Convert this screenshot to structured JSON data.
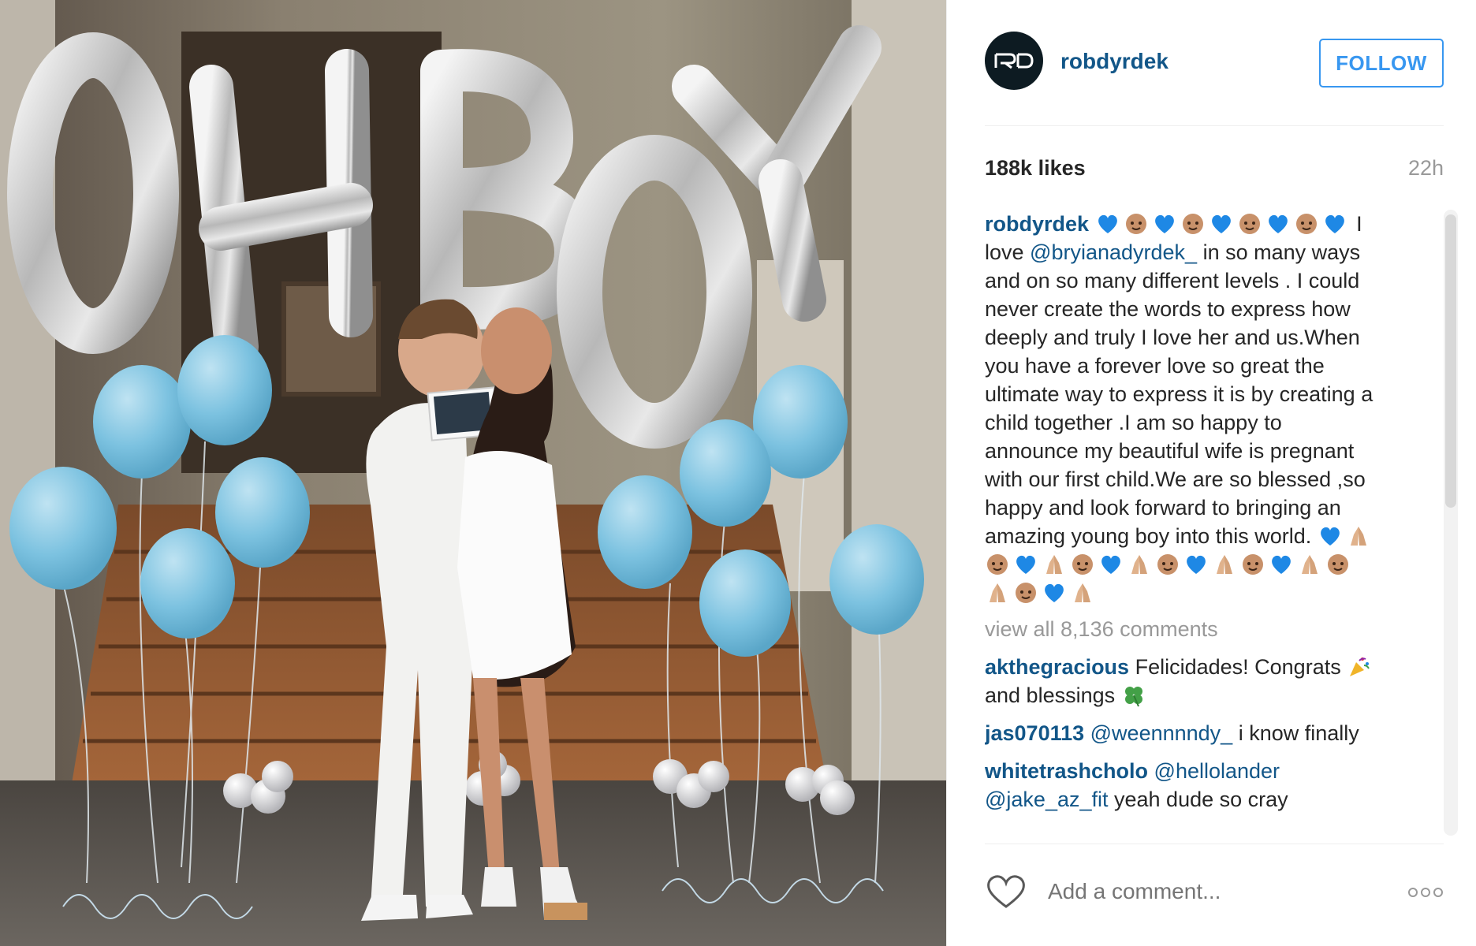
{
  "post": {
    "username": "robdyrdek",
    "follow_label": "FOLLOW",
    "likes": "188k likes",
    "time": "22h",
    "photo_balloon_text": "OH BOY",
    "caption": {
      "user": "robdyrdek",
      "line1_end": "I",
      "line2_a": "love ",
      "line2_mention": "@bryianadyrdek_",
      "line2_b": " in so many ways",
      "lines": [
        "and on so many different levels . I could",
        "never create the words to express how",
        "deeply and truly I love her and us.When",
        "you have a forever love so great the",
        "ultimate way to express it is by creating a",
        "child together .I am so happy to",
        "announce my beautiful wife is pregnant",
        "with our first child.We are so blessed ,so",
        "happy and look forward to bringing an"
      ],
      "last_line": "amazing young boy into this world. "
    },
    "view_all": "view all 8,136 comments",
    "comments": [
      {
        "user": "akthegracious",
        "text_a": " Felicidades! Congrats ",
        "text_b": "and blessings "
      },
      {
        "user": "jas070113",
        "mention": " @weennnndy_",
        "text": " i know finally"
      },
      {
        "user": "whitetrashcholo",
        "mention": " @hellolander",
        "mention2": "@jake_az_fit",
        "text": " yeah dude so cray"
      }
    ],
    "add_comment_placeholder": "Add a comment...",
    "colors": {
      "username": "#125688",
      "follow": "#3897f0",
      "muted": "#999999",
      "text": "#262626"
    },
    "icons": {
      "heart": "heart-outline-icon",
      "more": "more-options-icon",
      "blue_heart": "blue-heart-emoji",
      "baby": "baby-emoji",
      "pray": "praying-hands-emoji",
      "party": "party-popper-emoji",
      "clover": "four-leaf-clover-emoji"
    }
  }
}
